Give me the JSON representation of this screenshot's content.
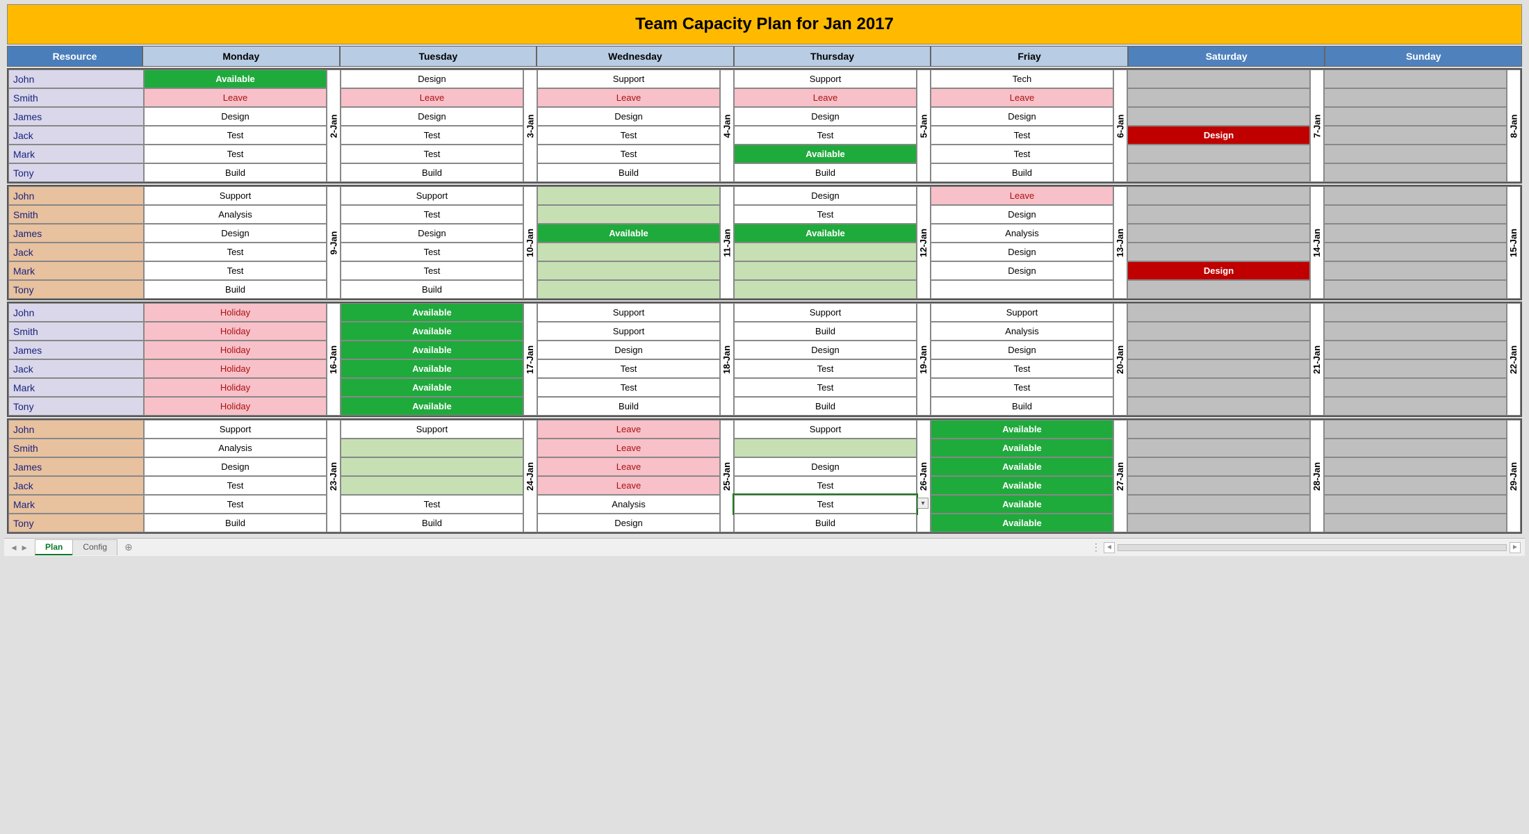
{
  "title": "Team Capacity Plan for Jan 2017",
  "headers": {
    "resource": "Resource",
    "days": [
      "Monday",
      "Tuesday",
      "Wednesday",
      "Thursday",
      "Friay",
      "Saturday",
      "Sunday"
    ]
  },
  "resources": [
    "John",
    "Smith",
    "James",
    "Jack",
    "Mark",
    "Tony"
  ],
  "weeks": [
    {
      "shade": "A",
      "dates": [
        "2-Jan",
        "3-Jan",
        "4-Jan",
        "5-Jan",
        "6-Jan",
        "7-Jan",
        "8-Jan"
      ],
      "matrix": [
        [
          {
            "t": "Available",
            "s": "avail"
          },
          {
            "t": "Design",
            "s": "white"
          },
          {
            "t": "Support",
            "s": "white"
          },
          {
            "t": "Support",
            "s": "white"
          },
          {
            "t": "Tech",
            "s": "white"
          },
          {
            "t": "",
            "s": "grey"
          },
          {
            "t": "",
            "s": "grey"
          }
        ],
        [
          {
            "t": "Leave",
            "s": "leave"
          },
          {
            "t": "Leave",
            "s": "leave"
          },
          {
            "t": "Leave",
            "s": "leave"
          },
          {
            "t": "Leave",
            "s": "leave"
          },
          {
            "t": "Leave",
            "s": "leave"
          },
          {
            "t": "",
            "s": "grey"
          },
          {
            "t": "",
            "s": "grey"
          }
        ],
        [
          {
            "t": "Design",
            "s": "white"
          },
          {
            "t": "Design",
            "s": "white"
          },
          {
            "t": "Design",
            "s": "white"
          },
          {
            "t": "Design",
            "s": "white"
          },
          {
            "t": "Design",
            "s": "white"
          },
          {
            "t": "",
            "s": "grey"
          },
          {
            "t": "",
            "s": "grey"
          }
        ],
        [
          {
            "t": "Test",
            "s": "white"
          },
          {
            "t": "Test",
            "s": "white"
          },
          {
            "t": "Test",
            "s": "white"
          },
          {
            "t": "Test",
            "s": "white"
          },
          {
            "t": "Test",
            "s": "white"
          },
          {
            "t": "Design",
            "s": "redfill"
          },
          {
            "t": "",
            "s": "grey"
          }
        ],
        [
          {
            "t": "Test",
            "s": "white"
          },
          {
            "t": "Test",
            "s": "white"
          },
          {
            "t": "Test",
            "s": "white"
          },
          {
            "t": "Available",
            "s": "avail"
          },
          {
            "t": "Test",
            "s": "white"
          },
          {
            "t": "",
            "s": "grey"
          },
          {
            "t": "",
            "s": "grey"
          }
        ],
        [
          {
            "t": "Build",
            "s": "white"
          },
          {
            "t": "Build",
            "s": "white"
          },
          {
            "t": "Build",
            "s": "white"
          },
          {
            "t": "Build",
            "s": "white"
          },
          {
            "t": "Build",
            "s": "white"
          },
          {
            "t": "",
            "s": "grey"
          },
          {
            "t": "",
            "s": "grey"
          }
        ]
      ]
    },
    {
      "shade": "B",
      "dates": [
        "9-Jan",
        "10-Jan",
        "11-Jan",
        "12-Jan",
        "13-Jan",
        "14-Jan",
        "15-Jan"
      ],
      "matrix": [
        [
          {
            "t": "Support",
            "s": "white"
          },
          {
            "t": "Support",
            "s": "white"
          },
          {
            "t": "",
            "s": "lightg"
          },
          {
            "t": "Design",
            "s": "white"
          },
          {
            "t": "Leave",
            "s": "leave"
          },
          {
            "t": "",
            "s": "grey"
          },
          {
            "t": "",
            "s": "grey"
          }
        ],
        [
          {
            "t": "Analysis",
            "s": "white"
          },
          {
            "t": "Test",
            "s": "white"
          },
          {
            "t": "",
            "s": "lightg"
          },
          {
            "t": "Test",
            "s": "white"
          },
          {
            "t": "Design",
            "s": "white"
          },
          {
            "t": "",
            "s": "grey"
          },
          {
            "t": "",
            "s": "grey"
          }
        ],
        [
          {
            "t": "Design",
            "s": "white"
          },
          {
            "t": "Design",
            "s": "white"
          },
          {
            "t": "Available",
            "s": "avail"
          },
          {
            "t": "Available",
            "s": "avail"
          },
          {
            "t": "Analysis",
            "s": "white"
          },
          {
            "t": "",
            "s": "grey"
          },
          {
            "t": "",
            "s": "grey"
          }
        ],
        [
          {
            "t": "Test",
            "s": "white"
          },
          {
            "t": "Test",
            "s": "white"
          },
          {
            "t": "",
            "s": "lightg"
          },
          {
            "t": "",
            "s": "lightg"
          },
          {
            "t": "Design",
            "s": "white"
          },
          {
            "t": "",
            "s": "grey"
          },
          {
            "t": "",
            "s": "grey"
          }
        ],
        [
          {
            "t": "Test",
            "s": "white"
          },
          {
            "t": "Test",
            "s": "white"
          },
          {
            "t": "",
            "s": "lightg"
          },
          {
            "t": "",
            "s": "lightg"
          },
          {
            "t": "Design",
            "s": "white"
          },
          {
            "t": "Design",
            "s": "redfill"
          },
          {
            "t": "",
            "s": "grey"
          }
        ],
        [
          {
            "t": "Build",
            "s": "white"
          },
          {
            "t": "Build",
            "s": "white"
          },
          {
            "t": "",
            "s": "lightg"
          },
          {
            "t": "",
            "s": "lightg"
          },
          {
            "t": "",
            "s": "white"
          },
          {
            "t": "",
            "s": "grey"
          },
          {
            "t": "",
            "s": "grey"
          }
        ]
      ]
    },
    {
      "shade": "A",
      "dates": [
        "16-Jan",
        "17-Jan",
        "18-Jan",
        "19-Jan",
        "20-Jan",
        "21-Jan",
        "22-Jan"
      ],
      "matrix": [
        [
          {
            "t": "Holiday",
            "s": "holiday"
          },
          {
            "t": "Available",
            "s": "avail"
          },
          {
            "t": "Support",
            "s": "white"
          },
          {
            "t": "Support",
            "s": "white"
          },
          {
            "t": "Support",
            "s": "white"
          },
          {
            "t": "",
            "s": "grey"
          },
          {
            "t": "",
            "s": "grey"
          }
        ],
        [
          {
            "t": "Holiday",
            "s": "holiday"
          },
          {
            "t": "Available",
            "s": "avail"
          },
          {
            "t": "Support",
            "s": "white"
          },
          {
            "t": "Build",
            "s": "white"
          },
          {
            "t": "Analysis",
            "s": "white"
          },
          {
            "t": "",
            "s": "grey"
          },
          {
            "t": "",
            "s": "grey"
          }
        ],
        [
          {
            "t": "Holiday",
            "s": "holiday"
          },
          {
            "t": "Available",
            "s": "avail"
          },
          {
            "t": "Design",
            "s": "white"
          },
          {
            "t": "Design",
            "s": "white"
          },
          {
            "t": "Design",
            "s": "white"
          },
          {
            "t": "",
            "s": "grey"
          },
          {
            "t": "",
            "s": "grey"
          }
        ],
        [
          {
            "t": "Holiday",
            "s": "holiday"
          },
          {
            "t": "Available",
            "s": "avail"
          },
          {
            "t": "Test",
            "s": "white"
          },
          {
            "t": "Test",
            "s": "white"
          },
          {
            "t": "Test",
            "s": "white"
          },
          {
            "t": "",
            "s": "grey"
          },
          {
            "t": "",
            "s": "grey"
          }
        ],
        [
          {
            "t": "Holiday",
            "s": "holiday"
          },
          {
            "t": "Available",
            "s": "avail"
          },
          {
            "t": "Test",
            "s": "white"
          },
          {
            "t": "Test",
            "s": "white"
          },
          {
            "t": "Test",
            "s": "white"
          },
          {
            "t": "",
            "s": "grey"
          },
          {
            "t": "",
            "s": "grey"
          }
        ],
        [
          {
            "t": "Holiday",
            "s": "holiday"
          },
          {
            "t": "Available",
            "s": "avail"
          },
          {
            "t": "Build",
            "s": "white"
          },
          {
            "t": "Build",
            "s": "white"
          },
          {
            "t": "Build",
            "s": "white"
          },
          {
            "t": "",
            "s": "grey"
          },
          {
            "t": "",
            "s": "grey"
          }
        ]
      ]
    },
    {
      "shade": "B",
      "dates": [
        "23-Jan",
        "24-Jan",
        "25-Jan",
        "26-Jan",
        "27-Jan",
        "28-Jan",
        "29-Jan"
      ],
      "matrix": [
        [
          {
            "t": "Support",
            "s": "white"
          },
          {
            "t": "Support",
            "s": "white"
          },
          {
            "t": "Leave",
            "s": "leave"
          },
          {
            "t": "Support",
            "s": "white"
          },
          {
            "t": "Available",
            "s": "avail"
          },
          {
            "t": "",
            "s": "grey"
          },
          {
            "t": "",
            "s": "grey"
          }
        ],
        [
          {
            "t": "Analysis",
            "s": "white"
          },
          {
            "t": "",
            "s": "lightg"
          },
          {
            "t": "Leave",
            "s": "leave"
          },
          {
            "t": "",
            "s": "lightg"
          },
          {
            "t": "Available",
            "s": "avail"
          },
          {
            "t": "",
            "s": "grey"
          },
          {
            "t": "",
            "s": "grey"
          }
        ],
        [
          {
            "t": "Design",
            "s": "white"
          },
          {
            "t": "",
            "s": "lightg"
          },
          {
            "t": "Leave",
            "s": "leave"
          },
          {
            "t": "Design",
            "s": "white"
          },
          {
            "t": "Available",
            "s": "avail"
          },
          {
            "t": "",
            "s": "grey"
          },
          {
            "t": "",
            "s": "grey"
          }
        ],
        [
          {
            "t": "Test",
            "s": "white"
          },
          {
            "t": "",
            "s": "lightg"
          },
          {
            "t": "Leave",
            "s": "leave"
          },
          {
            "t": "Test",
            "s": "white"
          },
          {
            "t": "Available",
            "s": "avail"
          },
          {
            "t": "",
            "s": "grey"
          },
          {
            "t": "",
            "s": "grey"
          }
        ],
        [
          {
            "t": "Test",
            "s": "white"
          },
          {
            "t": "Test",
            "s": "white"
          },
          {
            "t": "Analysis",
            "s": "white"
          },
          {
            "t": "Test",
            "s": "white",
            "dd": true
          },
          {
            "t": "Available",
            "s": "avail"
          },
          {
            "t": "",
            "s": "grey"
          },
          {
            "t": "",
            "s": "grey"
          }
        ],
        [
          {
            "t": "Build",
            "s": "white"
          },
          {
            "t": "Build",
            "s": "white"
          },
          {
            "t": "Design",
            "s": "white"
          },
          {
            "t": "Build",
            "s": "white"
          },
          {
            "t": "Available",
            "s": "avail"
          },
          {
            "t": "",
            "s": "grey"
          },
          {
            "t": "",
            "s": "grey"
          }
        ]
      ]
    }
  ],
  "tabs": {
    "list": [
      "Plan",
      "Config"
    ],
    "active": "Plan"
  },
  "icons": {
    "add": "⊕",
    "left": "◄",
    "right": "►",
    "dd": "▾",
    "navsep": "⋮"
  }
}
